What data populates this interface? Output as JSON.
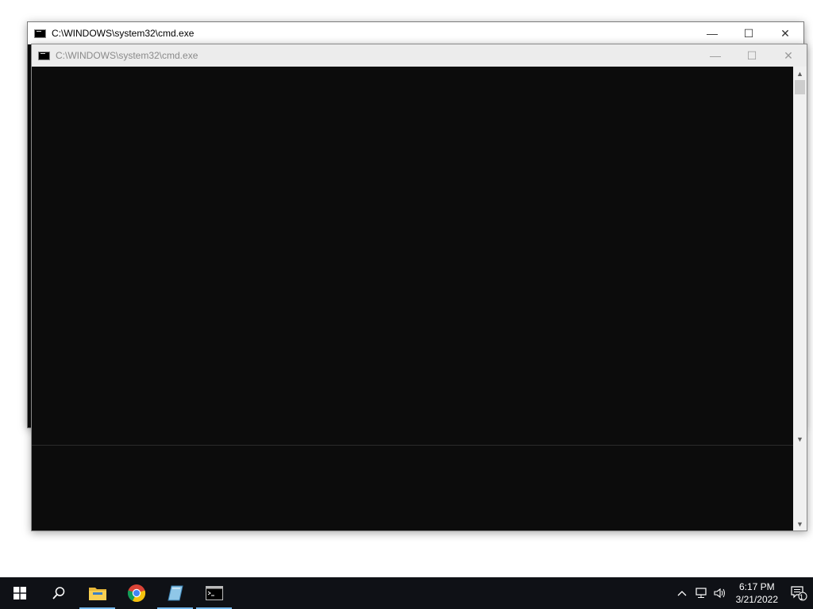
{
  "windows": {
    "back": {
      "title": "C:\\WINDOWS\\system32\\cmd.exe",
      "minimize_glyph": "—",
      "maximize_glyph": "☐",
      "close_glyph": "✕"
    },
    "front": {
      "title": "C:\\WINDOWS\\system32\\cmd.exe",
      "minimize_glyph": "—",
      "maximize_glyph": "☐",
      "close_glyph": "✕"
    }
  },
  "taskbar": {
    "items": [
      {
        "name": "start-button",
        "icon": "windows-logo-icon"
      },
      {
        "name": "search-button",
        "icon": "search-icon"
      },
      {
        "name": "file-explorer-button",
        "icon": "folder-icon"
      },
      {
        "name": "chrome-button",
        "icon": "chrome-icon"
      },
      {
        "name": "app-button",
        "icon": "blue-book-icon"
      },
      {
        "name": "cmd-taskbar-button",
        "icon": "cmd-icon"
      }
    ],
    "tray": {
      "time": "6:17 PM",
      "date": "3/21/2022",
      "notification_count": "1"
    }
  },
  "colors": {
    "console_bg": "#0c0c0c",
    "taskbar_bg": "#0f1116",
    "active_indicator": "#76b9ed"
  }
}
